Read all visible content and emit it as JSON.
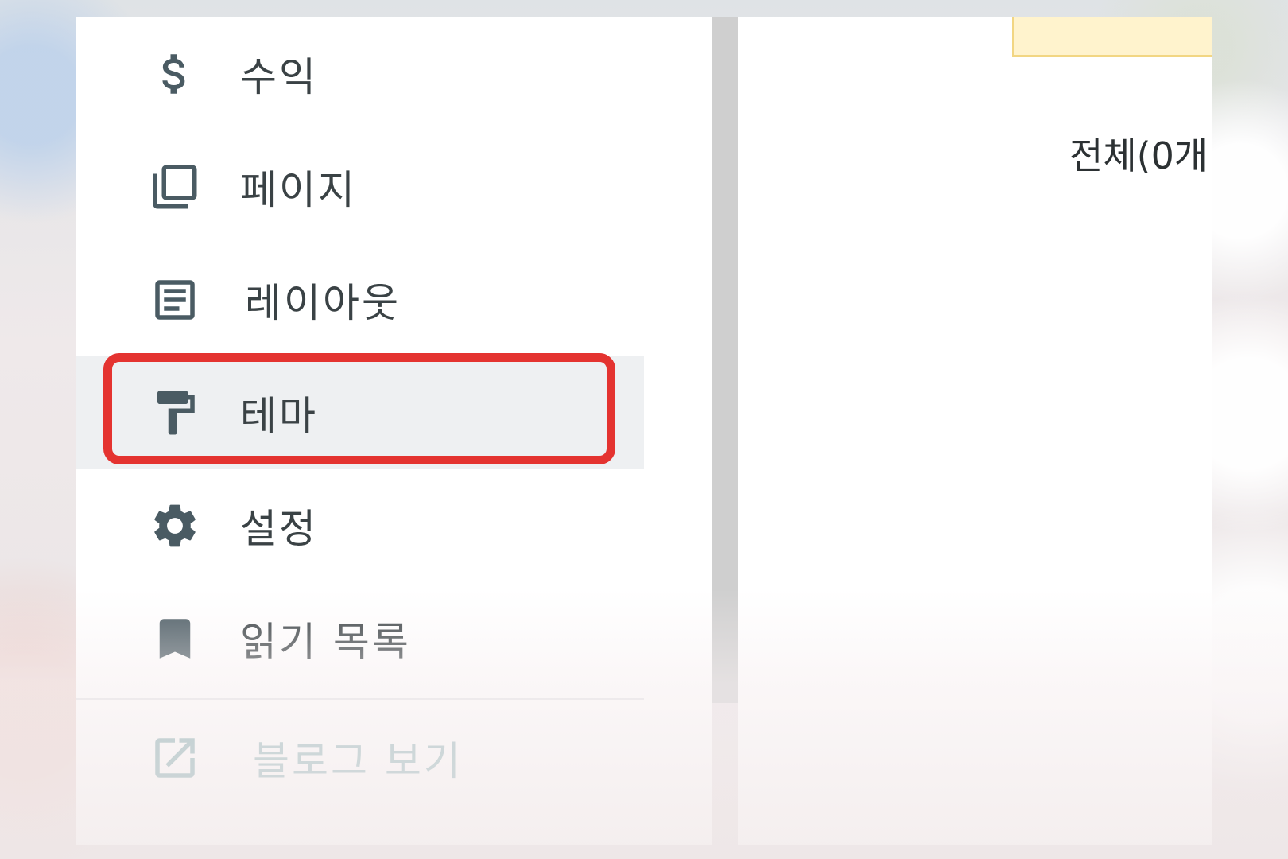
{
  "sidebar": {
    "items": [
      {
        "label": "수익",
        "icon": "dollar-icon"
      },
      {
        "label": "페이지",
        "icon": "pages-icon"
      },
      {
        "label": "레이아웃",
        "icon": "layout-icon"
      },
      {
        "label": "테마",
        "icon": "paint-roller-icon",
        "selected": true
      },
      {
        "label": "설정",
        "icon": "gear-icon"
      },
      {
        "label": "읽기 목록",
        "icon": "bookmark-icon"
      },
      {
        "label": "블로그 보기",
        "icon": "open-external-icon"
      }
    ]
  },
  "content": {
    "total_count_label": "전체(0개"
  },
  "colors": {
    "icon": "#455a64",
    "highlight": "#e43330",
    "selected_bg": "#eef0f2",
    "view_blog": "#8fb4b8"
  }
}
